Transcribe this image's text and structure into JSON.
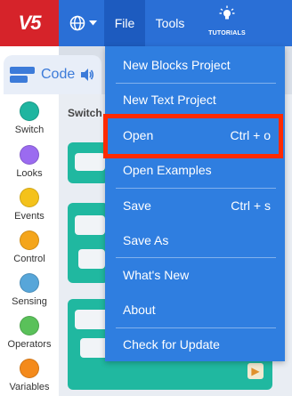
{
  "topbar": {
    "logo": "V5",
    "file_label": "File",
    "tools_label": "Tools",
    "tutorials_label": "TUTORIALS"
  },
  "code_tab": {
    "label": "Code"
  },
  "categories": [
    {
      "label": "Switch",
      "color": "#1fb5a0"
    },
    {
      "label": "Looks",
      "color": "#9b6bf0"
    },
    {
      "label": "Events",
      "color": "#f4c21b"
    },
    {
      "label": "Control",
      "color": "#f4a51b"
    },
    {
      "label": "Sensing",
      "color": "#57a6d9"
    },
    {
      "label": "Operators",
      "color": "#5ac15a"
    },
    {
      "label": "Variables",
      "color": "#f48a1b"
    }
  ],
  "palette": {
    "title": "Switch"
  },
  "file_menu": {
    "items": [
      {
        "label": "New Blocks Project",
        "shortcut": ""
      },
      {
        "label": "New Text Project",
        "shortcut": ""
      },
      {
        "label": "Open",
        "shortcut": "Ctrl + o"
      },
      {
        "label": "Open Examples",
        "shortcut": ""
      },
      {
        "label": "Save",
        "shortcut": "Ctrl + s"
      },
      {
        "label": "Save As",
        "shortcut": ""
      },
      {
        "label": "What's New",
        "shortcut": ""
      },
      {
        "label": "About",
        "shortcut": ""
      },
      {
        "label": "Check for Update",
        "shortcut": ""
      }
    ]
  }
}
